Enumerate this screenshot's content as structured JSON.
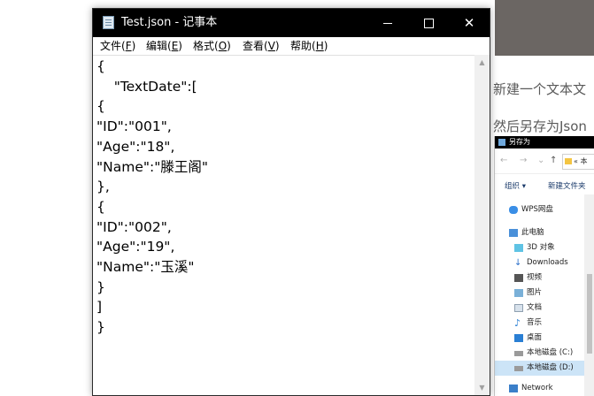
{
  "notepad": {
    "title": "Test.json - 记事本",
    "controls": {
      "minimize": "minimize",
      "maximize": "maximize",
      "close": "✕"
    },
    "menu": [
      {
        "label": "文件(",
        "key": "F",
        "suffix": ")"
      },
      {
        "label": "编辑(",
        "key": "E",
        "suffix": ")"
      },
      {
        "label": "格式(",
        "key": "O",
        "suffix": ")"
      },
      {
        "label": "查看(",
        "key": "V",
        "suffix": ")"
      },
      {
        "label": "帮助(",
        "key": "H",
        "suffix": ")"
      }
    ],
    "content": "{\n    \"TextDate\":[\n{\n\"ID\":\"001\",\n\"Age\":\"18\",\n\"Name\":\"滕王阁\"\n},\n{\n\"ID\":\"002\",\n\"Age\":\"19\",\n\"Name\":\"玉溪\"\n}\n]\n}"
  },
  "background_article": {
    "line1": "新建一个文本文",
    "line2": "然后另存为Json"
  },
  "save_as_dialog": {
    "title": "另存为",
    "folder_crumb": "« 本",
    "organize": "组织 ▾",
    "new_folder": "新建文件夹",
    "tree": [
      {
        "label": "WPS网盘",
        "icon": "cloud-icon"
      },
      {
        "label": "此电脑",
        "icon": "computer-icon"
      },
      {
        "label": "3D 对象",
        "icon": "cube-icon"
      },
      {
        "label": "Downloads",
        "icon": "download-icon"
      },
      {
        "label": "视频",
        "icon": "video-icon"
      },
      {
        "label": "图片",
        "icon": "picture-icon"
      },
      {
        "label": "文档",
        "icon": "document-icon"
      },
      {
        "label": "音乐",
        "icon": "music-icon"
      },
      {
        "label": "桌面",
        "icon": "desktop-icon"
      },
      {
        "label": "本地磁盘 (C:)",
        "icon": "drive-icon"
      },
      {
        "label": "本地磁盘 (D:)",
        "icon": "drive-icon"
      },
      {
        "label": "Network",
        "icon": "network-icon"
      }
    ]
  }
}
